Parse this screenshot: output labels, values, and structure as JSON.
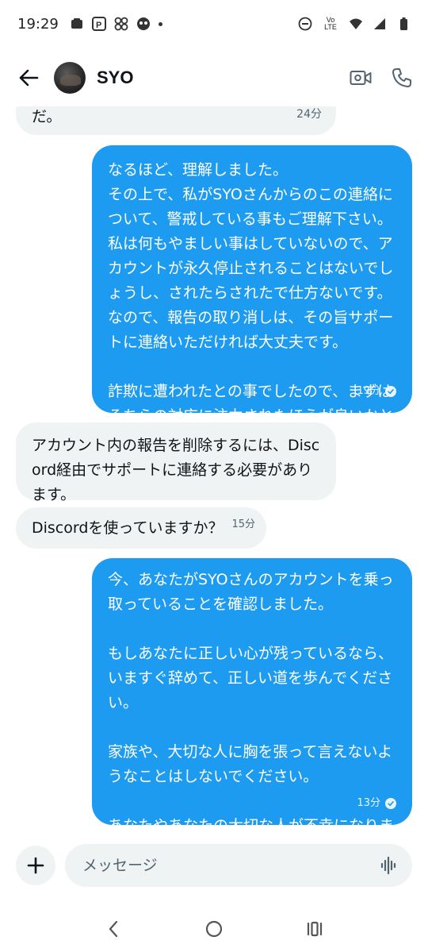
{
  "status_bar": {
    "time": "19:29",
    "network_label": "Vo LTE"
  },
  "header": {
    "contact_name": "SYO",
    "icons": [
      "back-arrow-icon",
      "video-call-icon",
      "phone-call-icon"
    ]
  },
  "messages": [
    {
      "direction": "in",
      "text": "だ。",
      "time": "24分",
      "read": false
    },
    {
      "direction": "out",
      "text": "なるほど、理解しました。\nその上で、私がSYOさんからのこの連絡について、警戒している事もご理解下さい。\n私は何もやましい事はしていないので、アカウントが永久停止されることはないでしょうし、されたらされたで仕方ないです。\nなので、報告の取り消しは、その旨サポートに連絡いただければ大丈夫です。\n\n詐欺に遭われたとの事でしたので、まずはそちらの対応に注力されたほうが良いかと思います。",
      "time": "19分",
      "read": true
    },
    {
      "direction": "in",
      "text": "アカウント内の報告を削除するには、Discord経由でサポートに連絡する必要があります。",
      "time": "",
      "read": false
    },
    {
      "direction": "in",
      "text": "Discordを使っていますか？",
      "time": "15分",
      "read": false
    },
    {
      "direction": "out",
      "text": "今、あなたがSYOさんのアカウントを乗っ取っていることを確認しました。\n\nもしあなたに正しい心が残っているなら、いますぐ辞めて、正しい道を歩んでください。\n\n家族や、大切な人に胸を張って言えないようなことはしないでください。\n\nあなたやあなたの大切な人が不幸になります。",
      "time": "13分",
      "read": true
    }
  ],
  "composer": {
    "placeholder": "メッセージ",
    "value": ""
  },
  "colors": {
    "outgoing_bubble": "#1d9bf0",
    "incoming_bubble": "#eff3f4",
    "text_primary": "#0f1419",
    "text_secondary": "#536471"
  }
}
